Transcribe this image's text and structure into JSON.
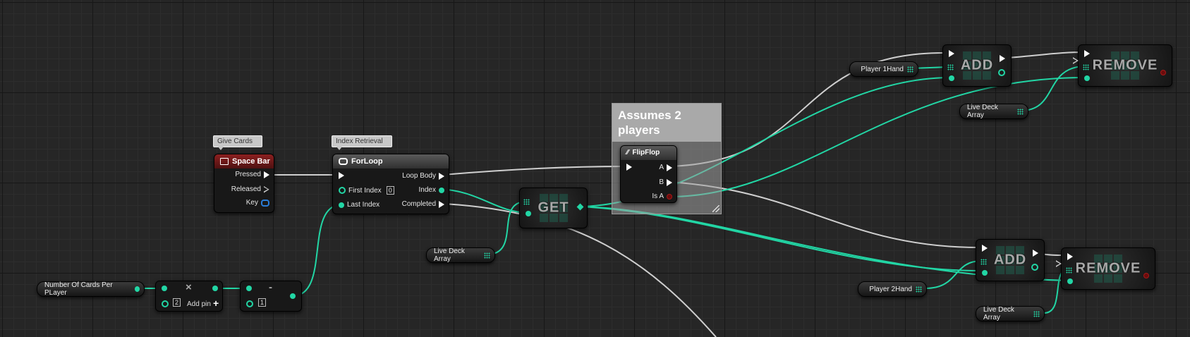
{
  "canvas": {
    "wire_exec_color": "#cfcfcf",
    "wire_data_color": "#22d6a5"
  },
  "comment_box": {
    "title": "Assumes 2 players"
  },
  "space_bar": {
    "comment": "Give Cards",
    "title": "Space Bar",
    "pins": {
      "pressed": "Pressed",
      "released": "Released",
      "key": "Key"
    },
    "header_color": "#8c2020"
  },
  "for_loop": {
    "comment": "Index Retrieval",
    "title": "ForLoop",
    "pins": {
      "loop_body": "Loop Body",
      "first_index": "First Index",
      "first_index_value": "0",
      "index": "Index",
      "last_index": "Last Index",
      "completed": "Completed"
    }
  },
  "flipflop": {
    "title": "FlipFlop",
    "pins": {
      "a": "A",
      "b": "B",
      "is_a": "Is A"
    }
  },
  "get_node": {
    "title": "GET"
  },
  "add_top": {
    "title": "ADD"
  },
  "remove_top": {
    "title": "REMOVE"
  },
  "add_bottom": {
    "title": "ADD"
  },
  "remove_bottom": {
    "title": "REMOVE"
  },
  "variables": {
    "num_cards": "Number Of Cards Per PLayer",
    "live_deck_1": "Live Deck Array",
    "live_deck_2": "Live Deck Array",
    "live_deck_3": "Live Deck Array",
    "player1": "Player 1Hand",
    "player2": "Player 2Hand"
  },
  "multiply": {
    "symbol": "×",
    "value": "2",
    "add_pin": "Add pin"
  },
  "subtract": {
    "symbol": "-",
    "value": "1"
  }
}
